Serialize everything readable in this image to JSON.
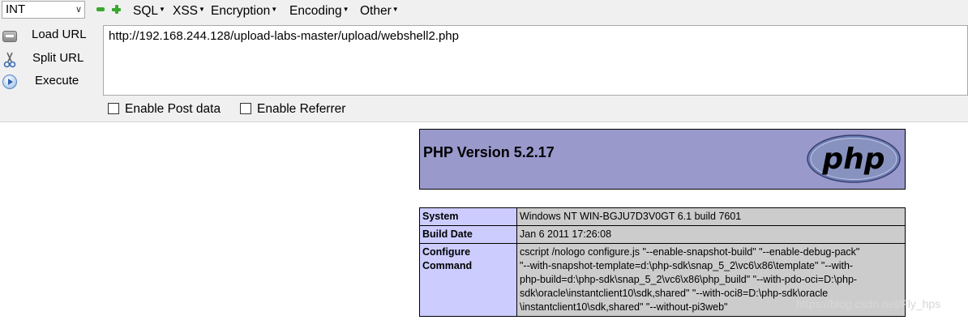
{
  "hackbar": {
    "type_select": {
      "value": "INT"
    },
    "menus": [
      {
        "label": "SQL"
      },
      {
        "label": "XSS"
      },
      {
        "label": "Encryption"
      },
      {
        "label": "Encoding"
      },
      {
        "label": "Other"
      }
    ],
    "actions": {
      "load_url": "Load URL",
      "split_url": "Split URL",
      "execute": "Execute"
    },
    "url_value": "http://192.168.244.128/upload-labs-master/upload/webshell2.php",
    "enable_post_label": "Enable Post data",
    "enable_referrer_label": "Enable Referrer",
    "enable_post_checked": false,
    "enable_referrer_checked": false
  },
  "phpinfo": {
    "title": "PHP Version 5.2.17",
    "logo_text": "php",
    "rows": [
      {
        "key": "System",
        "value": "Windows NT WIN-BGJU7D3V0GT 6.1 build 7601"
      },
      {
        "key": "Build Date",
        "value": "Jan 6 2011 17:26:08"
      },
      {
        "key_lines": [
          "Configure",
          "Command"
        ],
        "value_lines": [
          "cscript /nologo configure.js \"--enable-snapshot-build\" \"--enable-debug-pack\"",
          "\"--with-snapshot-template=d:\\php-sdk\\snap_5_2\\vc6\\x86\\template\" \"--with-",
          "php-build=d:\\php-sdk\\snap_5_2\\vc6\\x86\\php_build\" \"--with-pdo-oci=D:\\php-",
          "sdk\\oracle\\instantclient10\\sdk,shared\" \"--with-oci8=D:\\php-sdk\\oracle",
          "\\instantclient10\\sdk,shared\" \"--without-pi3web\""
        ]
      }
    ]
  },
  "watermark": "https://blog.csdn.net/Fly_hps",
  "colors": {
    "toolbar_bg": "#f0f0f0",
    "php_header": "#9999cc",
    "key_cell": "#ccccff",
    "value_cell": "#cccccc"
  }
}
